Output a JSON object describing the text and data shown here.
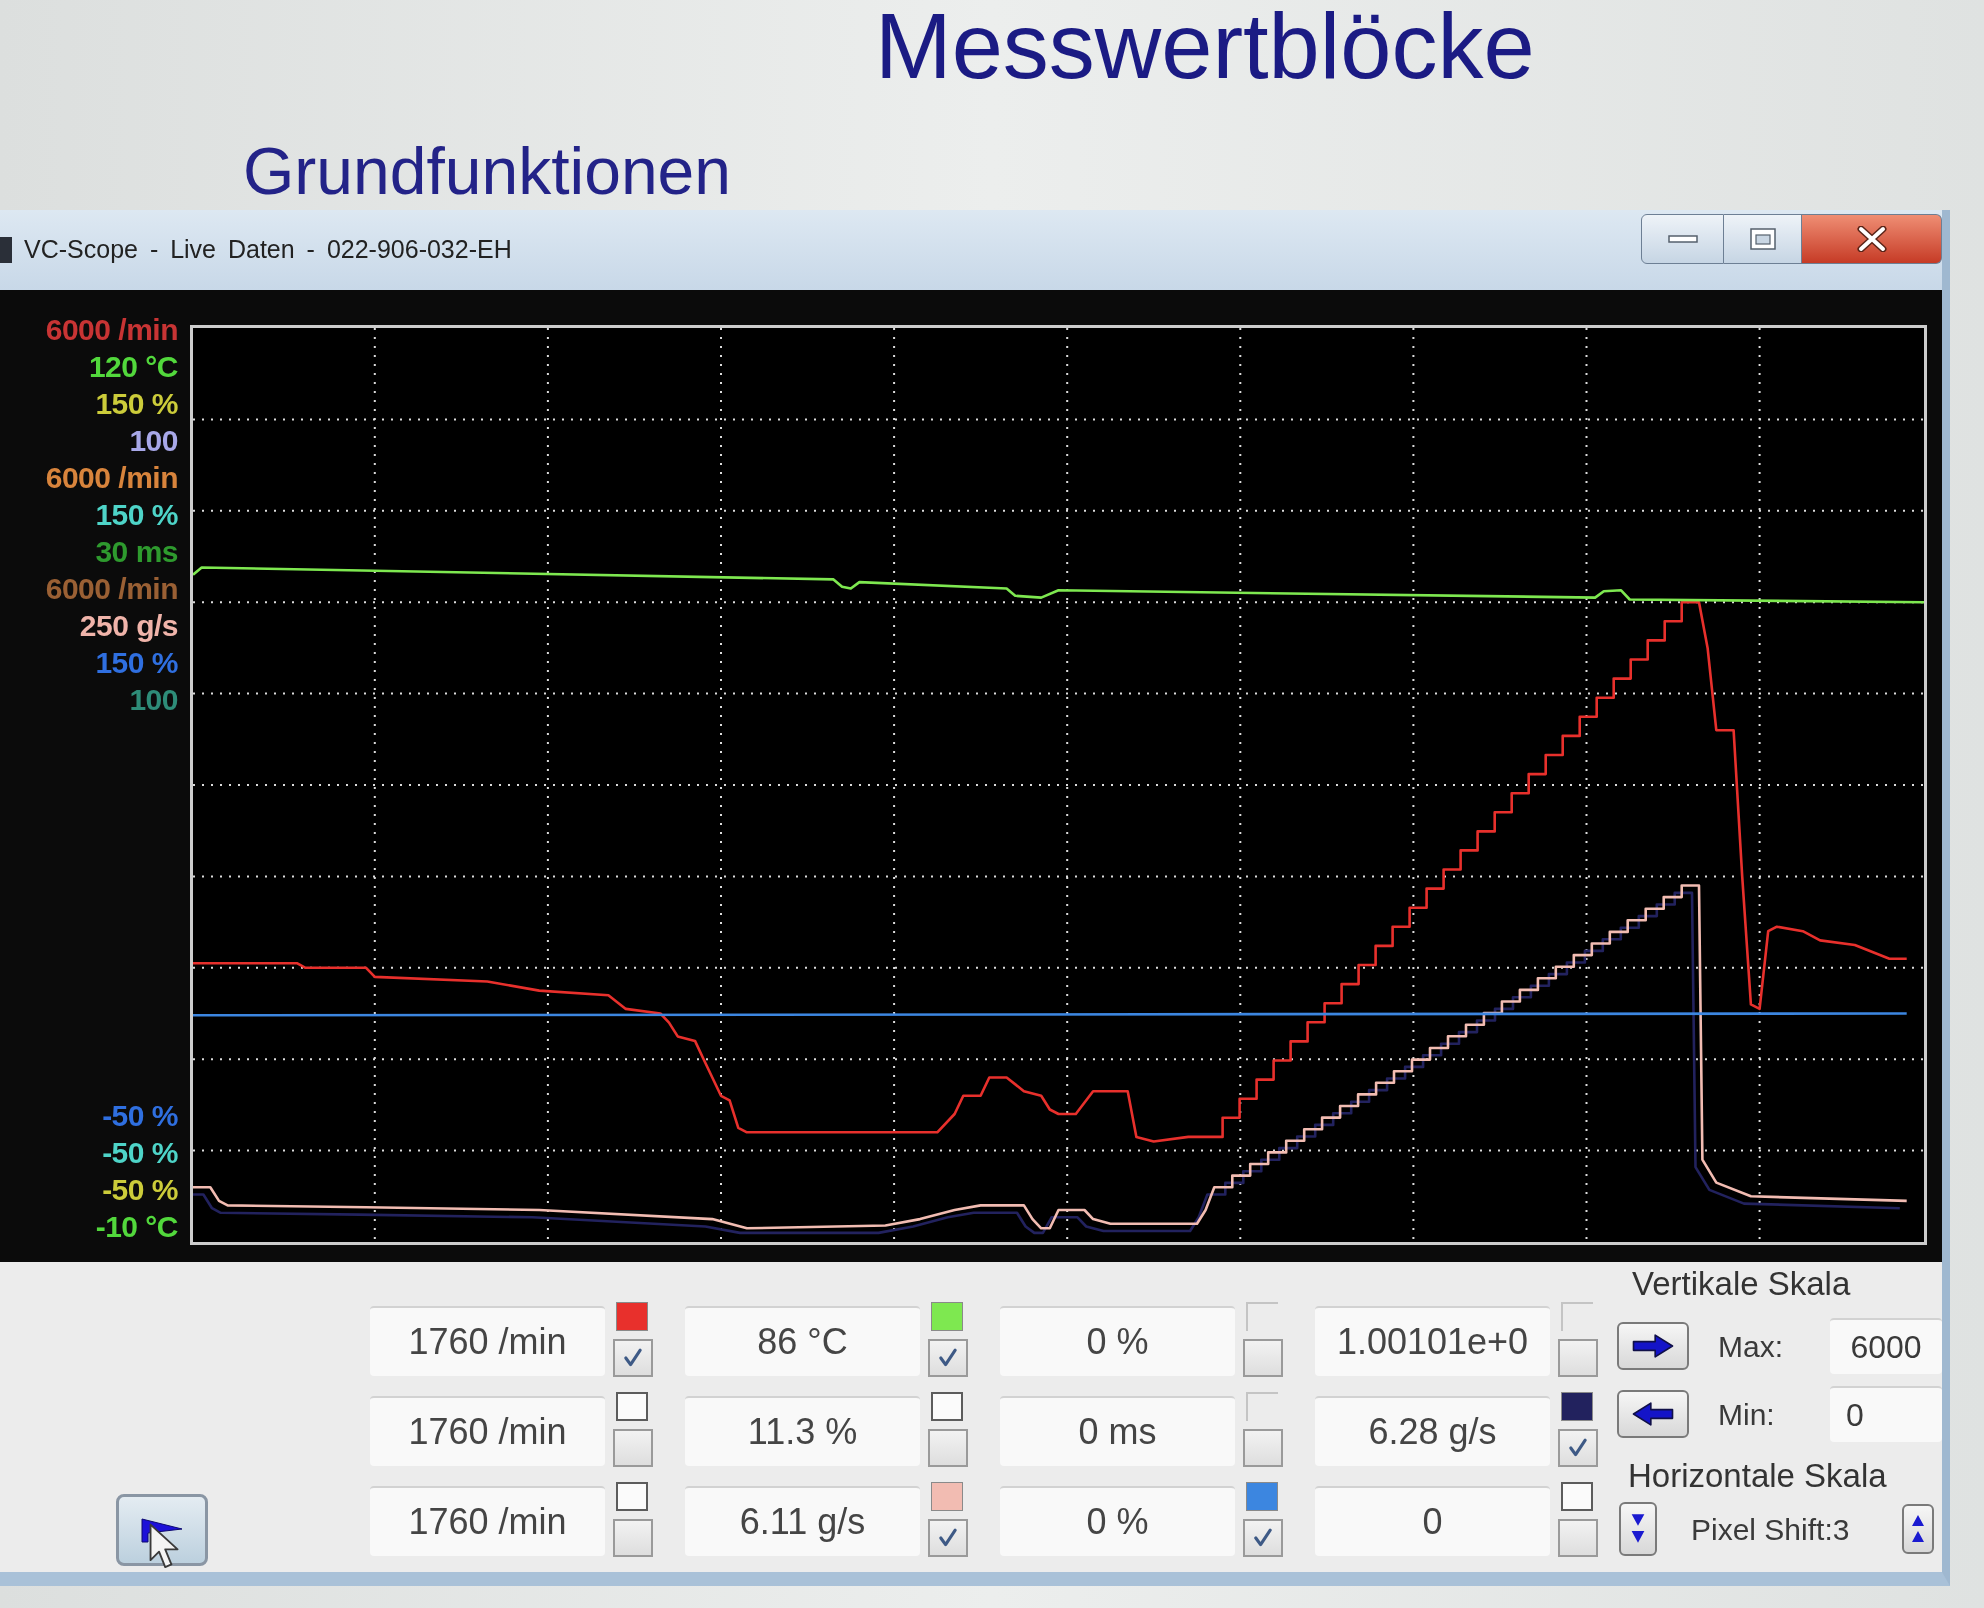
{
  "slide": {
    "heading": "Messwertblöcke",
    "subheading": "Grundfunktionen"
  },
  "window": {
    "title": "VC-Scope - Live Daten - 022-906-032-EH"
  },
  "scale_labels_top": [
    {
      "text": "6000 /min",
      "color": "#c83434"
    },
    {
      "text": "120 °C",
      "color": "#52d83c"
    },
    {
      "text": "150 %",
      "color": "#cccc3a"
    },
    {
      "text": "100",
      "color": "#a8a8e8"
    },
    {
      "text": "6000 /min",
      "color": "#d8843c"
    },
    {
      "text": "150 %",
      "color": "#4ed4c8"
    },
    {
      "text": "30 ms",
      "color": "#2e9a2e"
    },
    {
      "text": "6000 /min",
      "color": "#9a6034"
    },
    {
      "text": "250 g/s",
      "color": "#f0b4aa"
    },
    {
      "text": "150 %",
      "color": "#2f6fe0"
    },
    {
      "text": "100",
      "color": "#2e8c78"
    }
  ],
  "scale_labels_bottom": [
    {
      "text": "-50 %",
      "color": "#2f6fe0"
    },
    {
      "text": "-50 %",
      "color": "#4ed4c8"
    },
    {
      "text": "-50 %",
      "color": "#cccc3a"
    },
    {
      "text": "-10 °C",
      "color": "#52d83c"
    }
  ],
  "channels": [
    {
      "value": "1760 /min",
      "checked": true,
      "color": "#e8302c",
      "swatch_greyed": false
    },
    {
      "value": "86 °C",
      "checked": true,
      "color": "#7ee850",
      "swatch_greyed": false
    },
    {
      "value": "0 %",
      "checked": false,
      "swatch_greyed": true
    },
    {
      "value": "1.00101e+0",
      "checked": false,
      "swatch_greyed": true
    },
    {
      "value": "1760 /min",
      "checked": false,
      "swatch_greyed": false
    },
    {
      "value": "11.3 %",
      "checked": false,
      "swatch_greyed": false
    },
    {
      "value": "0 ms",
      "checked": false,
      "swatch_greyed": true
    },
    {
      "value": "6.28 g/s",
      "checked": true,
      "color": "#22225e",
      "swatch_greyed": false
    },
    {
      "value": "1760 /min",
      "checked": false,
      "swatch_greyed": false
    },
    {
      "value": "6.11 g/s",
      "checked": true,
      "color": "#f2bcb2",
      "swatch_greyed": false
    },
    {
      "value": "0 %",
      "checked": true,
      "color": "#3c86e0",
      "swatch_greyed": false
    },
    {
      "value": "0",
      "checked": false,
      "swatch_greyed": false
    }
  ],
  "vertical_scale": {
    "title": "Vertikale Skala",
    "max_label": "Max:",
    "max_value": "6000",
    "min_label": "Min:",
    "min_value": "0"
  },
  "horizontal_scale": {
    "title": "Horizontale Skala",
    "label": "Pixel Shift:3"
  }
}
